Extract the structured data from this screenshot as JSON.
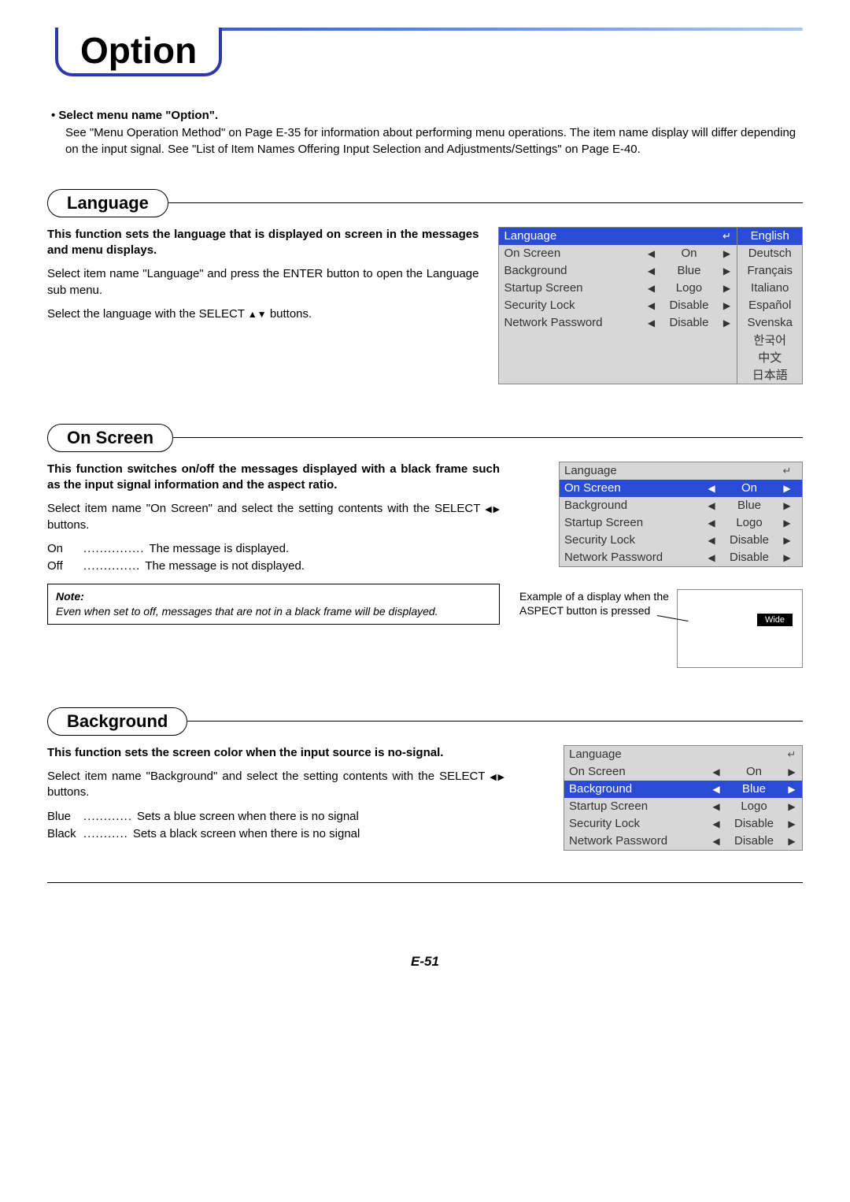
{
  "page_title": "Option",
  "intro_lead_bullet": "•  Select menu name \"Option\".",
  "intro_body": "See \"Menu Operation Method\" on Page E-35 for information about performing menu operations. The item name display will differ depending on the input signal. See \"List of Item Names Offering Input Selection and Adjustments/Settings\" on Page E-40.",
  "sections": {
    "language": {
      "heading": "Language",
      "bold": "This function sets the language that is displayed on screen in the messages and menu displays.",
      "p1": "Select item name \"Language\" and press the ENTER button to open the Language sub menu.",
      "p2_pre": "Select the language with the SELECT ",
      "p2_post": " buttons.",
      "menu": {
        "rows": [
          {
            "name": "Language",
            "val": "",
            "icon": "↵",
            "sel": true,
            "arrows": false
          },
          {
            "name": "On Screen",
            "val": "On",
            "sel": false,
            "arrows": true
          },
          {
            "name": "Background",
            "val": "Blue",
            "sel": false,
            "arrows": true
          },
          {
            "name": "Startup Screen",
            "val": "Logo",
            "sel": false,
            "arrows": true
          },
          {
            "name": "Security Lock",
            "val": "Disable",
            "sel": false,
            "arrows": true
          },
          {
            "name": "Network Password",
            "val": "Disable",
            "sel": false,
            "arrows": true
          }
        ],
        "languages": [
          {
            "label": "English",
            "sel": true
          },
          {
            "label": "Deutsch"
          },
          {
            "label": "Français"
          },
          {
            "label": "Italiano"
          },
          {
            "label": "Español"
          },
          {
            "label": "Svenska"
          },
          {
            "label": "한국어"
          },
          {
            "label": "中文"
          },
          {
            "label": "日本語"
          }
        ]
      }
    },
    "onscreen": {
      "heading": "On Screen",
      "bold": "This function switches on/off the messages displayed with a black frame such as the input signal information and the aspect ratio.",
      "p1_pre": "Select item name \"On Screen\" and select the setting contents with the SELECT ",
      "p1_post": " buttons.",
      "on_k": "On",
      "on_dots": "...............",
      "on_v": "The message is displayed.",
      "off_k": "Off",
      "off_dots": "..............",
      "off_v": "The message is not displayed.",
      "note_h": "Note:",
      "note_b": "Even when set to off, messages that are not in a black frame will be displayed.",
      "menu": {
        "rows": [
          {
            "name": "Language",
            "val": "",
            "icon": "↵",
            "sel": false,
            "arrows": false
          },
          {
            "name": "On Screen",
            "val": "On",
            "sel": true,
            "arrows": true
          },
          {
            "name": "Background",
            "val": "Blue",
            "sel": false,
            "arrows": true
          },
          {
            "name": "Startup Screen",
            "val": "Logo",
            "sel": false,
            "arrows": true
          },
          {
            "name": "Security Lock",
            "val": "Disable",
            "sel": false,
            "arrows": true
          },
          {
            "name": "Network Password",
            "val": "Disable",
            "sel": false,
            "arrows": true
          }
        ]
      },
      "example_label": "Example of a display when the ASPECT button is pressed",
      "example_tag": "Wide"
    },
    "background": {
      "heading": "Background",
      "bold": "This function sets the screen color when the input source is no-signal.",
      "p1_pre": "Select item name \"Background\" and select the setting contents with the SELECT ",
      "p1_post": " buttons.",
      "blue_k": "Blue",
      "blue_dots": "............",
      "blue_v": "Sets a blue screen when there is no signal",
      "black_k": "Black",
      "black_dots": "...........",
      "black_v": "Sets a black screen when there is no signal",
      "menu": {
        "rows": [
          {
            "name": "Language",
            "val": "",
            "icon": "↵",
            "sel": false,
            "arrows": false
          },
          {
            "name": "On Screen",
            "val": "On",
            "sel": false,
            "arrows": true
          },
          {
            "name": "Background",
            "val": "Blue",
            "sel": true,
            "arrows": true
          },
          {
            "name": "Startup Screen",
            "val": "Logo",
            "sel": false,
            "arrows": true
          },
          {
            "name": "Security Lock",
            "val": "Disable",
            "sel": false,
            "arrows": true
          },
          {
            "name": "Network Password",
            "val": "Disable",
            "sel": false,
            "arrows": true
          }
        ]
      }
    }
  },
  "glyphs": {
    "left": "◀",
    "right": "▶",
    "up": "▲",
    "down": "▼",
    "enter": "↵"
  },
  "page_number": "E-51"
}
